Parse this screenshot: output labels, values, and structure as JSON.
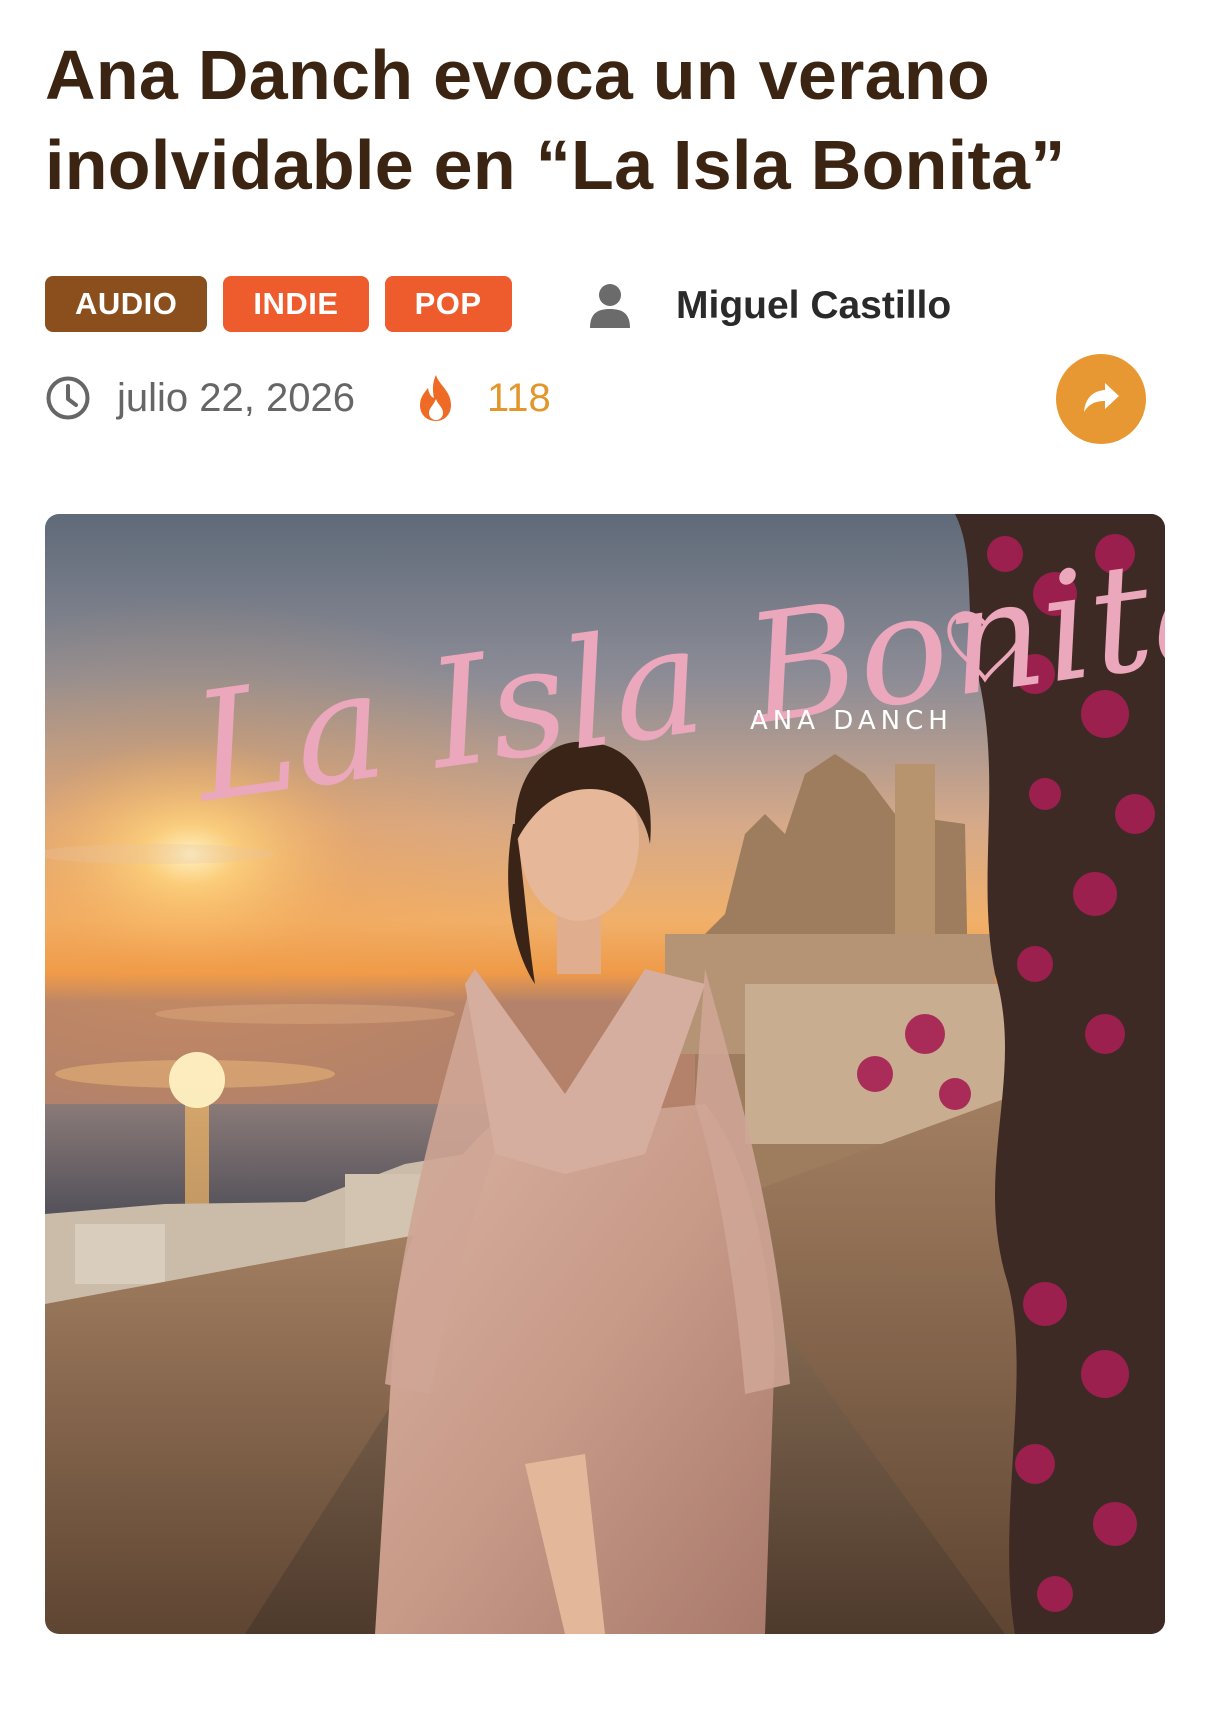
{
  "article": {
    "title_line1": "Ana Danch evoca un verano",
    "title_line2": "inolvidable en “La Isla Bonita”",
    "tags": [
      {
        "label": "AUDIO",
        "color": "#8b4f1d"
      },
      {
        "label": "INDIE",
        "color": "#ee5b2c"
      },
      {
        "label": "POP",
        "color": "#ee5b2c"
      }
    ],
    "author": "Miguel Castillo",
    "date": "julio 22, 2026",
    "views": "118"
  },
  "cover": {
    "title": "La Isla Bonita",
    "artist": "ANA DANCH"
  },
  "icons": {
    "author": "user-icon",
    "date": "clock-icon",
    "views": "fire-icon",
    "share": "share-icon"
  },
  "colors": {
    "title": "#3b2412",
    "share_button": "#e89832",
    "views": "#e3962b"
  }
}
